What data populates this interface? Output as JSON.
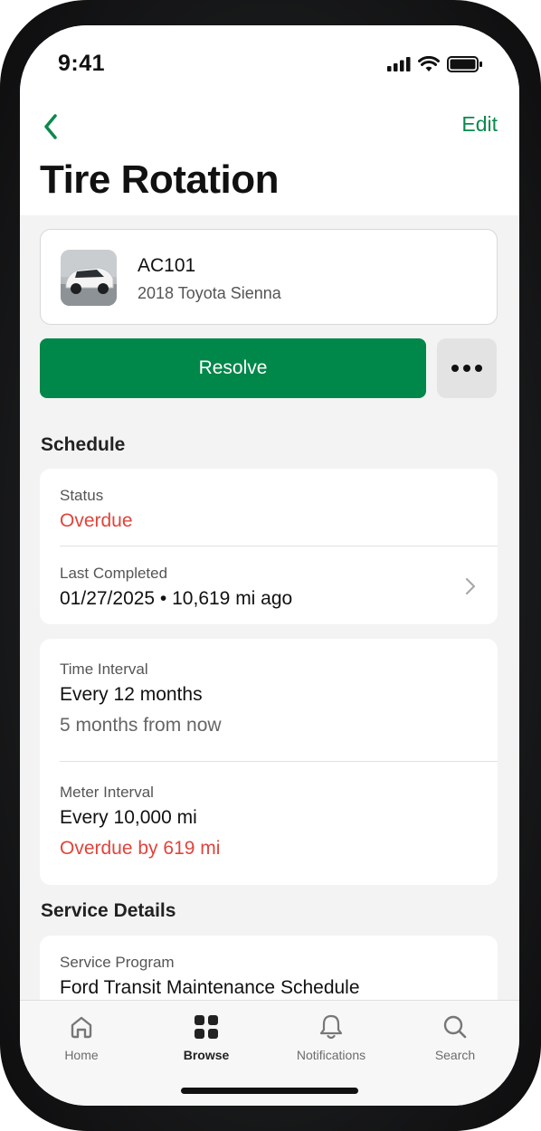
{
  "status_bar": {
    "time": "9:41",
    "icons": [
      "cellular-signal-icon",
      "wifi-icon",
      "battery-icon"
    ]
  },
  "nav": {
    "back_icon": "chevron-left-icon",
    "edit_label": "Edit"
  },
  "page_title": "Tire Rotation",
  "vehicle": {
    "name": "AC101",
    "description": "2018 Toyota Sienna"
  },
  "actions": {
    "resolve_label": "Resolve",
    "more_icon": "ellipsis-icon"
  },
  "schedule": {
    "heading": "Schedule",
    "status": {
      "label": "Status",
      "value": "Overdue"
    },
    "last_completed": {
      "label": "Last Completed",
      "value": "01/27/2025 • 10,619 mi ago"
    },
    "time_interval": {
      "label": "Time Interval",
      "value": "Every 12 months",
      "sub": "5 months from now"
    },
    "meter_interval": {
      "label": "Meter Interval",
      "value": "Every 10,000 mi",
      "sub": "Overdue by 619 mi"
    }
  },
  "service_details": {
    "heading": "Service Details",
    "service_program": {
      "label": "Service Program",
      "value": "Ford Transit Maintenance Schedule"
    }
  },
  "tabs": [
    {
      "label": "Home",
      "icon": "home-icon",
      "active": false
    },
    {
      "label": "Browse",
      "icon": "grid-icon",
      "active": true
    },
    {
      "label": "Notifications",
      "icon": "bell-icon",
      "active": false
    },
    {
      "label": "Search",
      "icon": "search-icon",
      "active": false
    }
  ],
  "colors": {
    "accent": "#00874a",
    "link": "#0b8a4d",
    "danger": "#e0443b"
  }
}
